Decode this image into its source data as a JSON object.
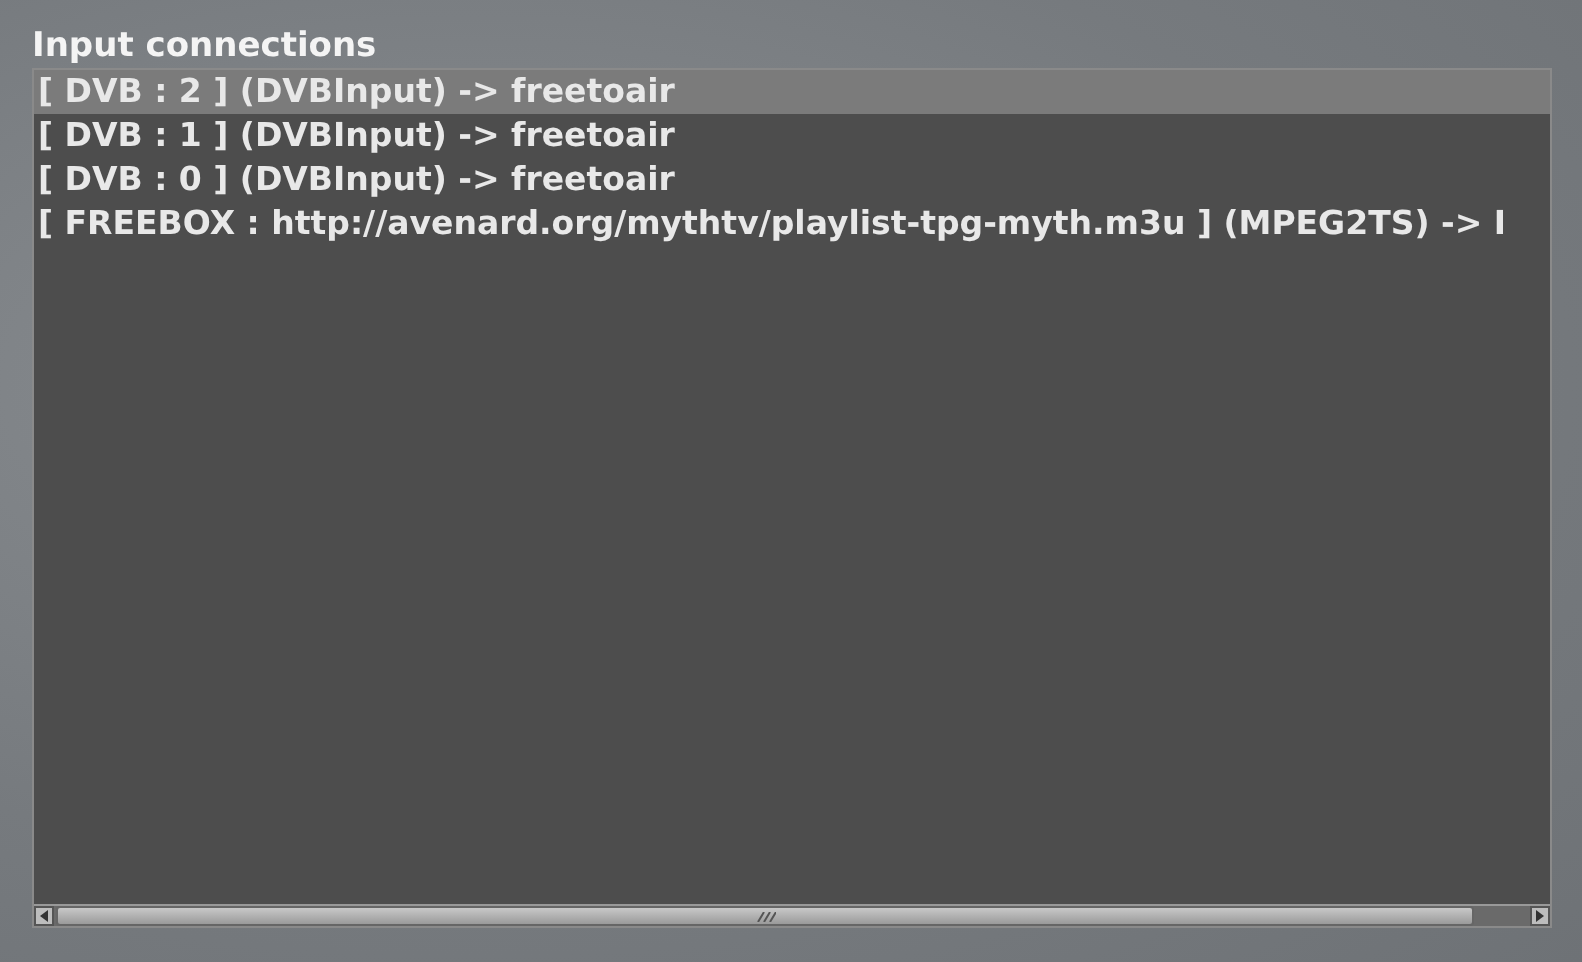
{
  "title": "Input connections",
  "connections": [
    {
      "label": "[ DVB : 2 ] (DVBInput) -> freetoair",
      "selected": true
    },
    {
      "label": "[ DVB : 1 ] (DVBInput) -> freetoair",
      "selected": false
    },
    {
      "label": "[ DVB : 0 ] (DVBInput) -> freetoair",
      "selected": false
    },
    {
      "label": "[ FREEBOX : http://avenard.org/mythtv/playlist-tpg-myth.m3u ] (MPEG2TS) -> I",
      "selected": false
    }
  ]
}
